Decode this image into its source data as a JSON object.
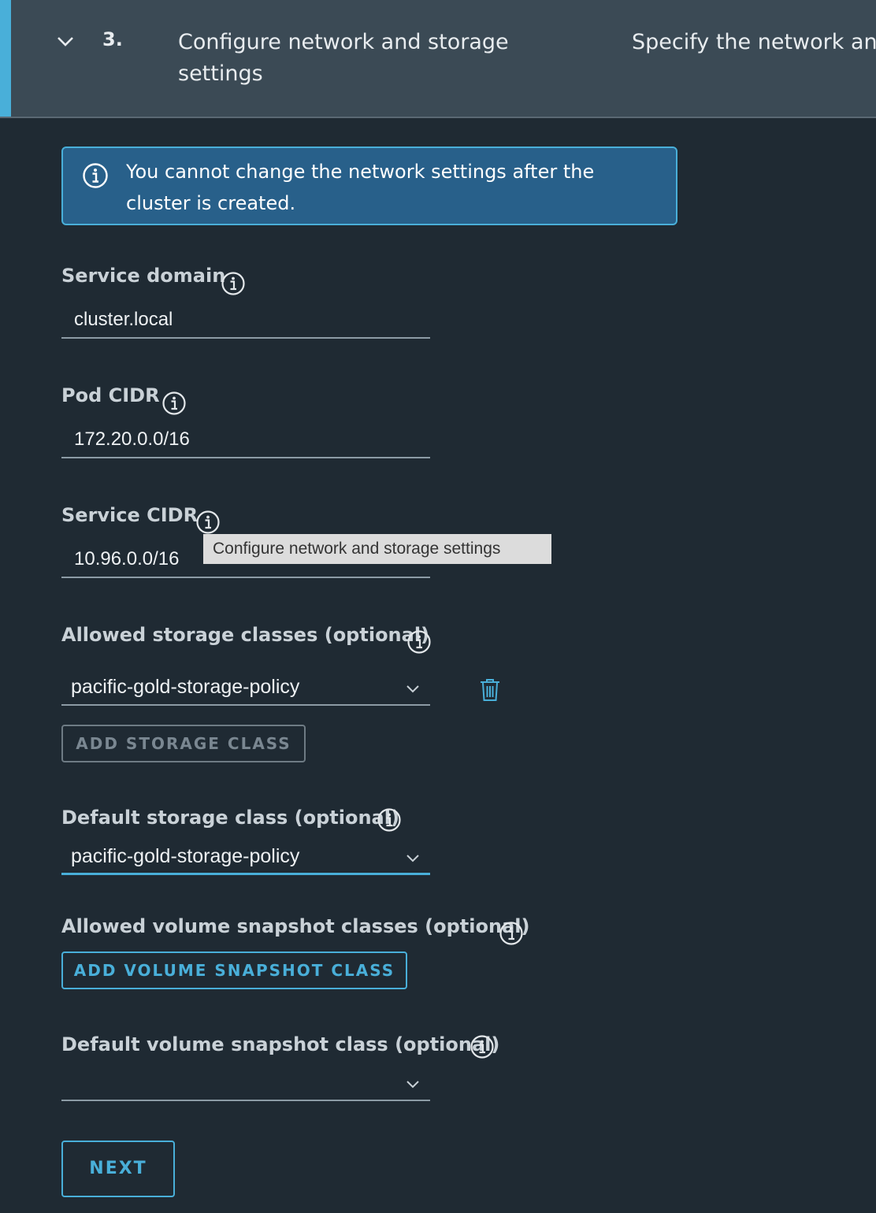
{
  "step": {
    "number": "3.",
    "title": "Configure network and storage settings",
    "description": "Specify the network an"
  },
  "alert": {
    "icon": "info-icon",
    "text": "You cannot change the network settings after the cluster is created."
  },
  "fields": {
    "service_domain": {
      "label": "Service domain",
      "value": "cluster.local"
    },
    "pod_cidr": {
      "label": "Pod CIDR",
      "value": "172.20.0.0/16"
    },
    "service_cidr": {
      "label": "Service CIDR",
      "value": "10.96.0.0/16"
    },
    "allowed_storage_classes": {
      "label": "Allowed storage classes (optional)",
      "selected": "pacific-gold-storage-policy",
      "add_button": "ADD STORAGE CLASS"
    },
    "default_storage_class": {
      "label": "Default storage class (optional)",
      "selected": "pacific-gold-storage-policy"
    },
    "allowed_volume_snapshot_classes": {
      "label": "Allowed volume snapshot classes (optional)",
      "add_button": "ADD VOLUME SNAPSHOT CLASS"
    },
    "default_volume_snapshot_class": {
      "label": "Default volume snapshot class (optional)",
      "selected": ""
    }
  },
  "tooltip": {
    "text": "Configure network and storage settings"
  },
  "next_button": "NEXT",
  "colors": {
    "background": "#1f2a33",
    "header": "#3b4a55",
    "accent": "#49afd9",
    "alert_bg": "#28608a"
  }
}
